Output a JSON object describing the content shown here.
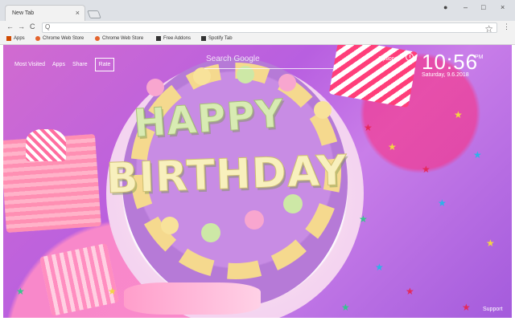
{
  "browser": {
    "tab_title": "New Tab",
    "tab_close": "×",
    "win_min": "–",
    "win_max": "□",
    "win_close": "×",
    "account_icon": "●"
  },
  "toolbar": {
    "back": "←",
    "forward": "→",
    "reload": "C",
    "search_icon": "Q",
    "bookmark_star": "☆",
    "menu": "⋮"
  },
  "bookmarks": [
    {
      "label": "Apps",
      "icon": "apps-grid-icon"
    },
    {
      "label": "Chrome Web Store",
      "icon": "chrome-web-store-icon"
    },
    {
      "label": "Chrome Web Store",
      "icon": "chrome-web-store-icon"
    },
    {
      "label": "Free Addons",
      "icon": "addons-icon"
    },
    {
      "label": "Spotify Tab",
      "icon": "spotify-tab-icon"
    }
  ],
  "page": {
    "nav": [
      "Most Visited",
      "Apps",
      "Share",
      "Rate"
    ],
    "search_placeholder": "Search Google",
    "options_label": "Options",
    "time": "10:56",
    "ampm": "PM",
    "date": "Saturday, 9.6.2018",
    "support_label": "Support",
    "cake_line1": "HAPPY",
    "cake_line2": "BIRTHDAY"
  }
}
